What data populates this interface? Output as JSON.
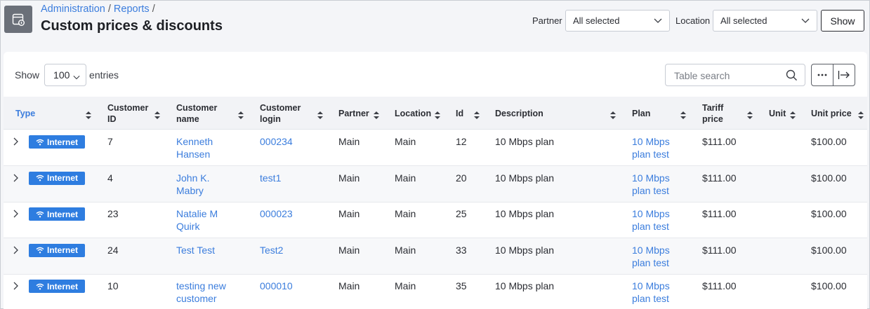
{
  "breadcrumb": {
    "item1": "Administration",
    "item2": "Reports",
    "sep": "/"
  },
  "page_title": "Custom prices & discounts",
  "filters": {
    "partner_label": "Partner",
    "partner_value": "All selected",
    "location_label": "Location",
    "location_value": "All selected",
    "show_label": "Show"
  },
  "entries": {
    "show_label": "Show",
    "value": "100",
    "entries_label": "entries"
  },
  "search": {
    "placeholder": "Table search"
  },
  "columns": {
    "type": "Type",
    "customer_id_1": "Customer",
    "customer_id_2": "ID",
    "customer_name_1": "Customer",
    "customer_name_2": "name",
    "customer_login_1": "Customer",
    "customer_login_2": "login",
    "partner": "Partner",
    "location": "Location",
    "id": "Id",
    "description": "Description",
    "plan": "Plan",
    "tariff_price_1": "Tariff",
    "tariff_price_2": "price",
    "unit": "Unit",
    "unit_price": "Unit price"
  },
  "rows": [
    {
      "type": "Internet",
      "customer_id": "7",
      "name1": "Kenneth",
      "name2": "Hansen",
      "login": "000234",
      "partner": "Main",
      "location": "Main",
      "id": "12",
      "description": "10 Mbps plan",
      "plan1": "10 Mbps",
      "plan2": "plan test",
      "tariff_price": "$111.00",
      "unit": "",
      "unit_price": "$100.00"
    },
    {
      "type": "Internet",
      "customer_id": "4",
      "name1": "John K.",
      "name2": "Mabry",
      "login": "test1",
      "partner": "Main",
      "location": "Main",
      "id": "20",
      "description": "10 Mbps plan",
      "plan1": "10 Mbps",
      "plan2": "plan test",
      "tariff_price": "$111.00",
      "unit": "",
      "unit_price": "$100.00"
    },
    {
      "type": "Internet",
      "customer_id": "23",
      "name1": "Natalie M",
      "name2": "Quirk",
      "login": "000023",
      "partner": "Main",
      "location": "Main",
      "id": "25",
      "description": "10 Mbps plan",
      "plan1": "10 Mbps",
      "plan2": "plan test",
      "tariff_price": "$111.00",
      "unit": "",
      "unit_price": "$100.00"
    },
    {
      "type": "Internet",
      "customer_id": "24",
      "name1": "Test Test",
      "name2": "",
      "login": "Test2",
      "partner": "Main",
      "location": "Main",
      "id": "33",
      "description": "10 Mbps plan",
      "plan1": "10 Mbps",
      "plan2": "plan test",
      "tariff_price": "$111.00",
      "unit": "",
      "unit_price": "$100.00"
    },
    {
      "type": "Internet",
      "customer_id": "10",
      "name1": "testing new",
      "name2": "customer",
      "login": "000010",
      "partner": "Main",
      "location": "Main",
      "id": "35",
      "description": "10 Mbps plan",
      "plan1": "10 Mbps",
      "plan2": "plan test",
      "tariff_price": "$111.00",
      "unit": "",
      "unit_price": "$100.00"
    }
  ],
  "colors": {
    "accent": "#3b7ddd",
    "badge": "#2e7de0",
    "icon_bg": "#6b7079"
  }
}
